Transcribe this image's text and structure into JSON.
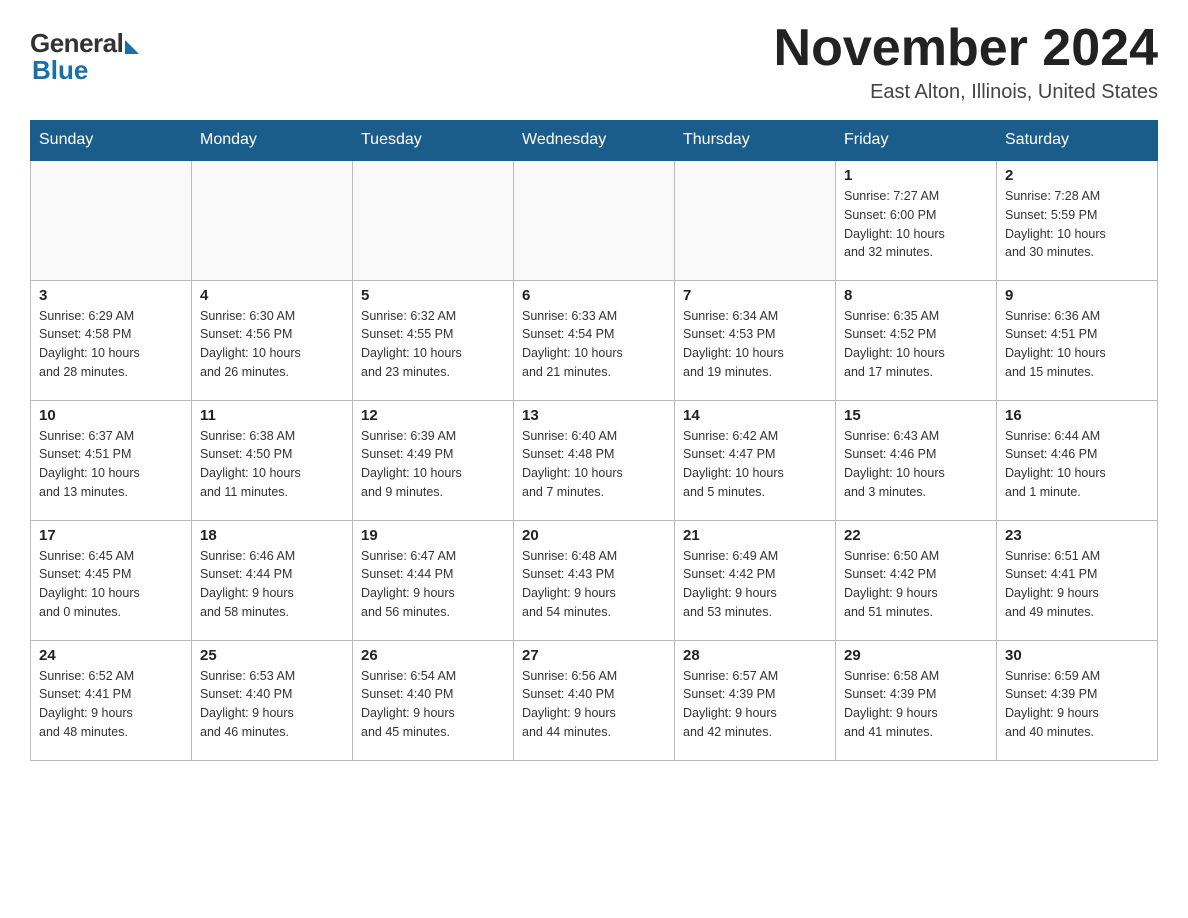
{
  "header": {
    "logo": {
      "general": "General",
      "blue": "Blue"
    },
    "title": "November 2024",
    "location": "East Alton, Illinois, United States"
  },
  "calendar": {
    "days_of_week": [
      "Sunday",
      "Monday",
      "Tuesday",
      "Wednesday",
      "Thursday",
      "Friday",
      "Saturday"
    ],
    "weeks": [
      [
        {
          "day": "",
          "info": ""
        },
        {
          "day": "",
          "info": ""
        },
        {
          "day": "",
          "info": ""
        },
        {
          "day": "",
          "info": ""
        },
        {
          "day": "",
          "info": ""
        },
        {
          "day": "1",
          "info": "Sunrise: 7:27 AM\nSunset: 6:00 PM\nDaylight: 10 hours\nand 32 minutes."
        },
        {
          "day": "2",
          "info": "Sunrise: 7:28 AM\nSunset: 5:59 PM\nDaylight: 10 hours\nand 30 minutes."
        }
      ],
      [
        {
          "day": "3",
          "info": "Sunrise: 6:29 AM\nSunset: 4:58 PM\nDaylight: 10 hours\nand 28 minutes."
        },
        {
          "day": "4",
          "info": "Sunrise: 6:30 AM\nSunset: 4:56 PM\nDaylight: 10 hours\nand 26 minutes."
        },
        {
          "day": "5",
          "info": "Sunrise: 6:32 AM\nSunset: 4:55 PM\nDaylight: 10 hours\nand 23 minutes."
        },
        {
          "day": "6",
          "info": "Sunrise: 6:33 AM\nSunset: 4:54 PM\nDaylight: 10 hours\nand 21 minutes."
        },
        {
          "day": "7",
          "info": "Sunrise: 6:34 AM\nSunset: 4:53 PM\nDaylight: 10 hours\nand 19 minutes."
        },
        {
          "day": "8",
          "info": "Sunrise: 6:35 AM\nSunset: 4:52 PM\nDaylight: 10 hours\nand 17 minutes."
        },
        {
          "day": "9",
          "info": "Sunrise: 6:36 AM\nSunset: 4:51 PM\nDaylight: 10 hours\nand 15 minutes."
        }
      ],
      [
        {
          "day": "10",
          "info": "Sunrise: 6:37 AM\nSunset: 4:51 PM\nDaylight: 10 hours\nand 13 minutes."
        },
        {
          "day": "11",
          "info": "Sunrise: 6:38 AM\nSunset: 4:50 PM\nDaylight: 10 hours\nand 11 minutes."
        },
        {
          "day": "12",
          "info": "Sunrise: 6:39 AM\nSunset: 4:49 PM\nDaylight: 10 hours\nand 9 minutes."
        },
        {
          "day": "13",
          "info": "Sunrise: 6:40 AM\nSunset: 4:48 PM\nDaylight: 10 hours\nand 7 minutes."
        },
        {
          "day": "14",
          "info": "Sunrise: 6:42 AM\nSunset: 4:47 PM\nDaylight: 10 hours\nand 5 minutes."
        },
        {
          "day": "15",
          "info": "Sunrise: 6:43 AM\nSunset: 4:46 PM\nDaylight: 10 hours\nand 3 minutes."
        },
        {
          "day": "16",
          "info": "Sunrise: 6:44 AM\nSunset: 4:46 PM\nDaylight: 10 hours\nand 1 minute."
        }
      ],
      [
        {
          "day": "17",
          "info": "Sunrise: 6:45 AM\nSunset: 4:45 PM\nDaylight: 10 hours\nand 0 minutes."
        },
        {
          "day": "18",
          "info": "Sunrise: 6:46 AM\nSunset: 4:44 PM\nDaylight: 9 hours\nand 58 minutes."
        },
        {
          "day": "19",
          "info": "Sunrise: 6:47 AM\nSunset: 4:44 PM\nDaylight: 9 hours\nand 56 minutes."
        },
        {
          "day": "20",
          "info": "Sunrise: 6:48 AM\nSunset: 4:43 PM\nDaylight: 9 hours\nand 54 minutes."
        },
        {
          "day": "21",
          "info": "Sunrise: 6:49 AM\nSunset: 4:42 PM\nDaylight: 9 hours\nand 53 minutes."
        },
        {
          "day": "22",
          "info": "Sunrise: 6:50 AM\nSunset: 4:42 PM\nDaylight: 9 hours\nand 51 minutes."
        },
        {
          "day": "23",
          "info": "Sunrise: 6:51 AM\nSunset: 4:41 PM\nDaylight: 9 hours\nand 49 minutes."
        }
      ],
      [
        {
          "day": "24",
          "info": "Sunrise: 6:52 AM\nSunset: 4:41 PM\nDaylight: 9 hours\nand 48 minutes."
        },
        {
          "day": "25",
          "info": "Sunrise: 6:53 AM\nSunset: 4:40 PM\nDaylight: 9 hours\nand 46 minutes."
        },
        {
          "day": "26",
          "info": "Sunrise: 6:54 AM\nSunset: 4:40 PM\nDaylight: 9 hours\nand 45 minutes."
        },
        {
          "day": "27",
          "info": "Sunrise: 6:56 AM\nSunset: 4:40 PM\nDaylight: 9 hours\nand 44 minutes."
        },
        {
          "day": "28",
          "info": "Sunrise: 6:57 AM\nSunset: 4:39 PM\nDaylight: 9 hours\nand 42 minutes."
        },
        {
          "day": "29",
          "info": "Sunrise: 6:58 AM\nSunset: 4:39 PM\nDaylight: 9 hours\nand 41 minutes."
        },
        {
          "day": "30",
          "info": "Sunrise: 6:59 AM\nSunset: 4:39 PM\nDaylight: 9 hours\nand 40 minutes."
        }
      ]
    ]
  }
}
